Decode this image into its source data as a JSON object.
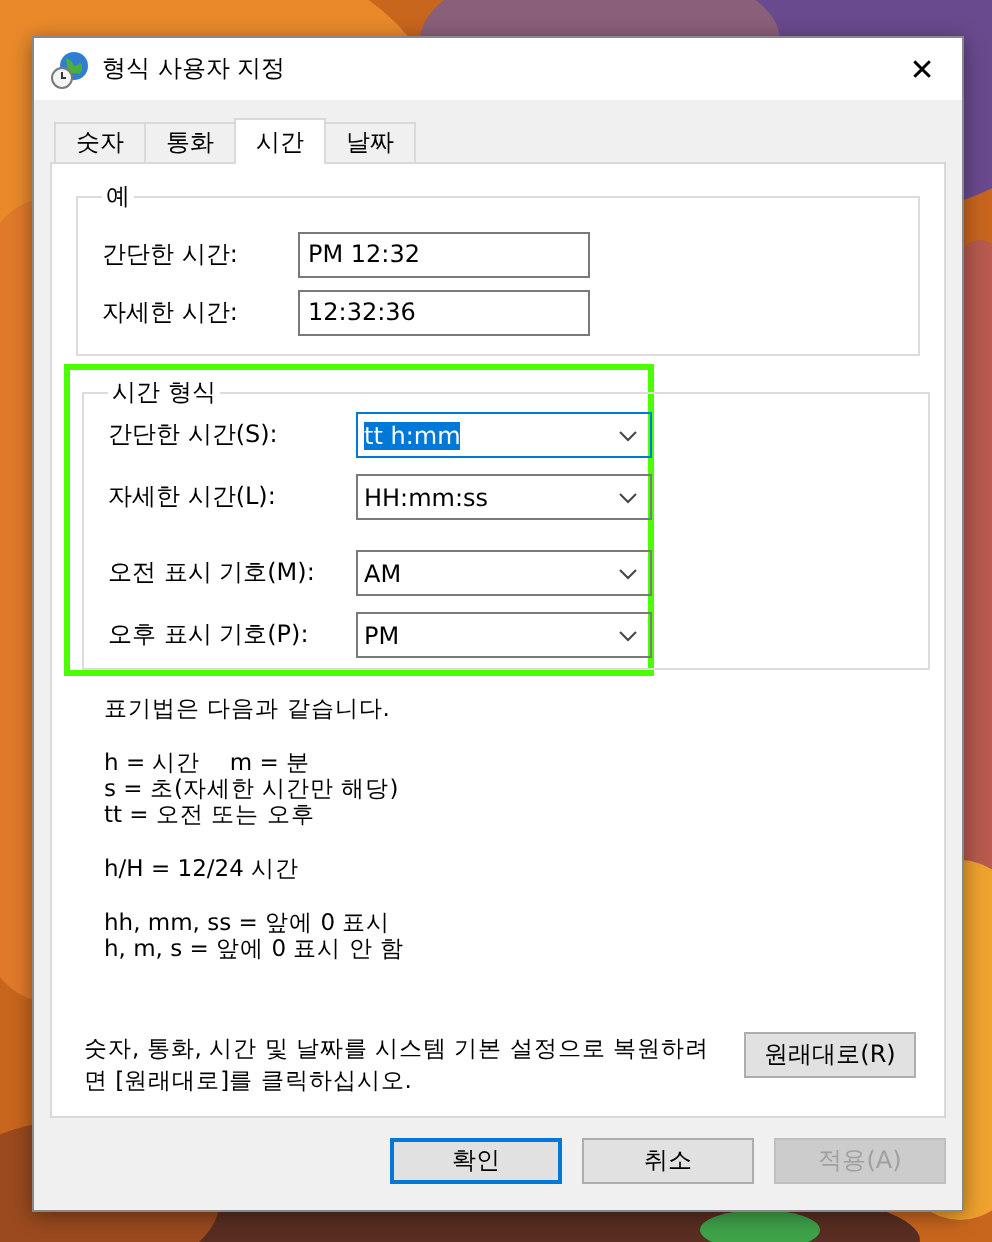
{
  "window": {
    "title": "형식 사용자 지정",
    "close": "✕"
  },
  "tabs": [
    {
      "label": "숫자",
      "selected": false
    },
    {
      "label": "통화",
      "selected": false
    },
    {
      "label": "시간",
      "selected": true
    },
    {
      "label": "날짜",
      "selected": false
    }
  ],
  "example": {
    "title": "예",
    "fields": [
      {
        "label": "간단한 시간:",
        "value": "PM 12:32"
      },
      {
        "label": "자세한 시간:",
        "value": "12:32:36"
      }
    ]
  },
  "time_format": {
    "title": "시간 형식",
    "highlighted": true,
    "combos": [
      {
        "label": "간단한 시간(S):",
        "value": "tt h:mm",
        "focused": true
      },
      {
        "label": "자세한 시간(L):",
        "value": "HH:mm:ss",
        "focused": false
      },
      {
        "label": "오전 표시 기호(M):",
        "value": "AM",
        "focused": false
      },
      {
        "label": "오후 표시 기호(P):",
        "value": "PM",
        "focused": false
      }
    ]
  },
  "notes": [
    [
      "표기법은 다음과 같습니다."
    ],
    [
      "h = 시간    m = 분",
      "s = 초(자세한 시간만 해당)",
      "tt = 오전 또는 오후"
    ],
    [
      "h/H = 12/24 시간"
    ],
    [
      "hh, mm, ss = 앞에 0 표시",
      "h, m, s = 앞에 0 표시 안 함"
    ]
  ],
  "restore": {
    "text": "숫자, 통화, 시간 및 날짜를 시스템 기본 설정으로 복원하려면 [원래대로]를 클릭하십시오.",
    "button": "원래대로(R)"
  },
  "buttons": [
    {
      "label": "확인",
      "default": true,
      "disabled": false
    },
    {
      "label": "취소",
      "default": false,
      "disabled": false
    },
    {
      "label": "적용(A)",
      "default": false,
      "disabled": true
    }
  ]
}
